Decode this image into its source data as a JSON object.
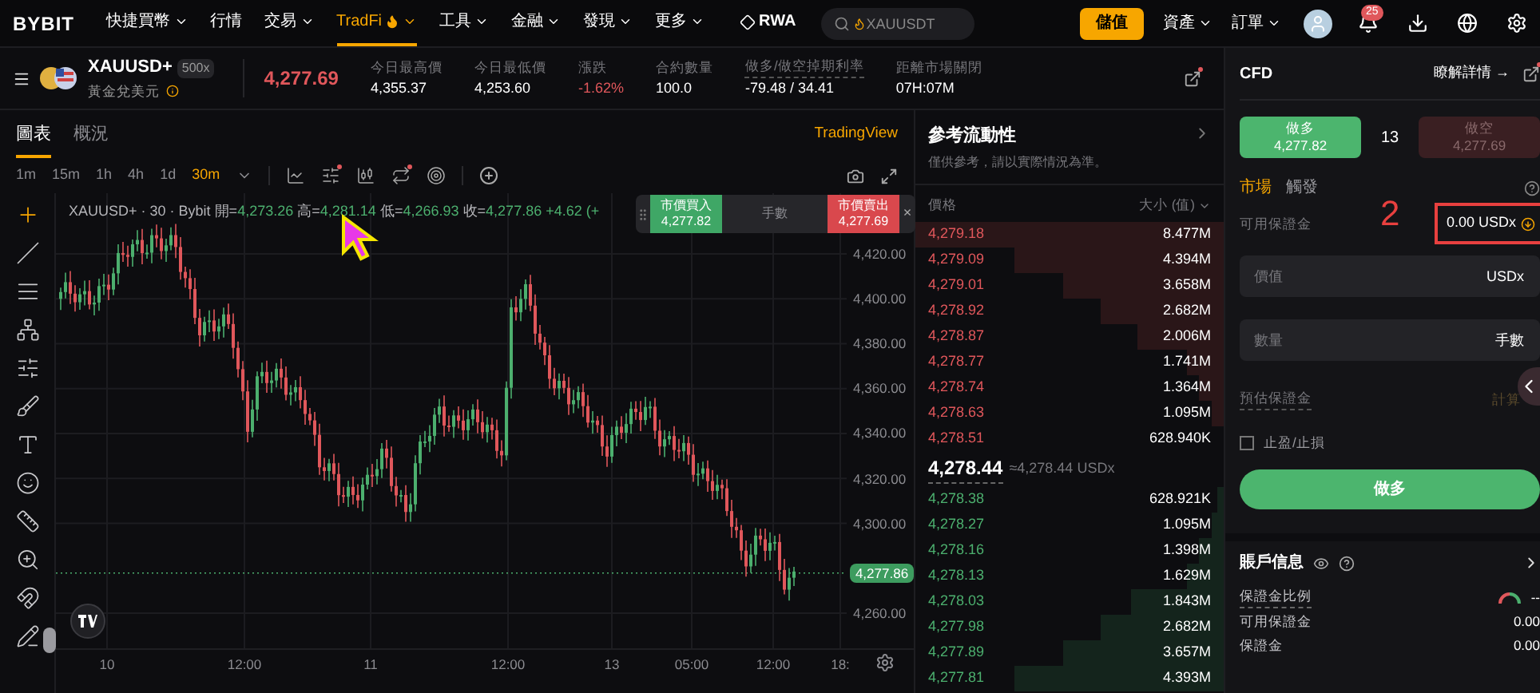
{
  "nav": {
    "logo": "BYBIT",
    "items": [
      {
        "label": "快捷買幣",
        "kind": "plain",
        "dropdown": true,
        "selected": false
      },
      {
        "label": "行情",
        "kind": "plain",
        "dropdown": false,
        "selected": false
      },
      {
        "label": "交易",
        "kind": "plain",
        "dropdown": true,
        "selected": false
      },
      {
        "label": "TradFi",
        "kind": "flame",
        "dropdown": true,
        "selected": true
      },
      {
        "label": "工具",
        "kind": "plain",
        "dropdown": true,
        "selected": false
      },
      {
        "label": "金融",
        "kind": "plain",
        "dropdown": true,
        "selected": false
      },
      {
        "label": "發現",
        "kind": "plain",
        "dropdown": true,
        "selected": false
      },
      {
        "label": "更多",
        "kind": "plain",
        "dropdown": true,
        "selected": false
      },
      {
        "label": "RWA",
        "kind": "brand",
        "dropdown": false,
        "selected": false
      }
    ],
    "search": {
      "placeholder": "XAUUSDT"
    },
    "deposit": "儲值",
    "menus": [
      "資產",
      "訂單"
    ],
    "notifications": "25"
  },
  "header": {
    "symbol": "XAUUSD+",
    "leverage": "500x",
    "name": "黃金兌美元",
    "price": "4,277.69",
    "stats": [
      {
        "label": "今日最高價",
        "value": "4,355.37",
        "negative": false,
        "dashed": false
      },
      {
        "label": "今日最低價",
        "value": "4,253.60",
        "negative": false,
        "dashed": false
      },
      {
        "label": "漲跌",
        "value": "-1.62%",
        "negative": true,
        "dashed": false
      },
      {
        "label": "合約數量",
        "value": "100.0",
        "negative": false,
        "dashed": false
      },
      {
        "label": "做多/做空掉期利率",
        "value": "-79.48 / 34.41",
        "negative": false,
        "dashed": true
      },
      {
        "label": "距離市場關閉",
        "value": "07H:07M",
        "negative": false,
        "dashed": false
      }
    ]
  },
  "chart_panel": {
    "tabs": [
      {
        "label": "圖表",
        "selected": true
      },
      {
        "label": "概況",
        "selected": false
      }
    ],
    "provider": "TradingView",
    "intervals": [
      {
        "label": "1m",
        "selected": false
      },
      {
        "label": "15m",
        "selected": false
      },
      {
        "label": "1h",
        "selected": false
      },
      {
        "label": "4h",
        "selected": false
      },
      {
        "label": "1d",
        "selected": false
      },
      {
        "label": "30m",
        "selected": true
      }
    ],
    "legend": {
      "title": "XAUUSD+ · 30 · Bybit",
      "fields": [
        {
          "label": "開=",
          "value": "4,273.26"
        },
        {
          "label": "高=",
          "value": "4,281.14"
        },
        {
          "label": "低=",
          "value": "4,266.93"
        },
        {
          "label": "收=",
          "value": "4,277.86"
        }
      ],
      "change": "+4.62 (+"
    },
    "quick_trade": {
      "buy_label": "市價買入",
      "buy_price": "4,277.82",
      "lots": "手數",
      "sell_label": "市價賣出",
      "sell_price": "4,277.69",
      "close": "×"
    },
    "y_ticks": [
      "4,420.00",
      "4,400.00",
      "4,380.00",
      "4,360.00",
      "4,340.00",
      "4,320.00",
      "4,300.00",
      "4,260.00"
    ],
    "last_price": "4,277.86",
    "x_ticks": [
      "10",
      "12:00",
      "11",
      "12:00",
      "13",
      "05:00",
      "12:00",
      "18:"
    ]
  },
  "order_book": {
    "title": "參考流動性",
    "subtitle": "僅供參考，請以實際情況為準。",
    "columns": [
      "價格",
      "大小 (值)"
    ],
    "asks": [
      {
        "price": "4,279.18",
        "size": "8.477M"
      },
      {
        "price": "4,279.09",
        "size": "4.394M"
      },
      {
        "price": "4,279.01",
        "size": "3.658M"
      },
      {
        "price": "4,278.92",
        "size": "2.682M"
      },
      {
        "price": "4,278.87",
        "size": "2.006M"
      },
      {
        "price": "4,278.77",
        "size": "1.741M"
      },
      {
        "price": "4,278.74",
        "size": "1.364M"
      },
      {
        "price": "4,278.63",
        "size": "1.095M"
      },
      {
        "price": "4,278.51",
        "size": "628.940K"
      }
    ],
    "mid": {
      "price": "4,278.44",
      "approx": "≈4,278.44 USDx"
    },
    "bids": [
      {
        "price": "4,278.38",
        "size": "628.921K"
      },
      {
        "price": "4,278.27",
        "size": "1.095M"
      },
      {
        "price": "4,278.16",
        "size": "1.398M"
      },
      {
        "price": "4,278.13",
        "size": "1.629M"
      },
      {
        "price": "4,278.03",
        "size": "1.843M"
      },
      {
        "price": "4,277.98",
        "size": "2.682M"
      },
      {
        "price": "4,277.89",
        "size": "3.657M"
      },
      {
        "price": "4,277.81",
        "size": "4.393M"
      }
    ]
  },
  "order_panel": {
    "title": "CFD",
    "details": "瞭解詳情 →",
    "sides": [
      {
        "label": "做多",
        "price": "4,277.82",
        "kind": "long",
        "selected": true
      },
      {
        "label": "做空",
        "price": "4,277.69",
        "kind": "short",
        "selected": false
      }
    ],
    "spread": "13",
    "order_types": [
      {
        "label": "市場",
        "selected": true
      },
      {
        "label": "觸發",
        "selected": false
      }
    ],
    "margin": {
      "label": "可用保證金",
      "value": "0.00 USDx"
    },
    "annotation": "2",
    "fields": [
      {
        "placeholder": "價值",
        "unit": "USDx"
      },
      {
        "placeholder": "數量",
        "unit": "手數"
      }
    ],
    "estimate": {
      "label": "預估保證金",
      "action": "計算"
    },
    "tpsl": {
      "label": "止盈/止損",
      "checked": false
    },
    "submit": "做多"
  },
  "account": {
    "title": "賬戶信息",
    "rows": [
      {
        "label": "保證金比例",
        "value": "--",
        "kind": "gauge"
      },
      {
        "label": "可用保證金",
        "value": "0.00",
        "kind": "plain"
      },
      {
        "label": "保證金",
        "value": "0.00",
        "kind": "plain"
      }
    ]
  }
}
